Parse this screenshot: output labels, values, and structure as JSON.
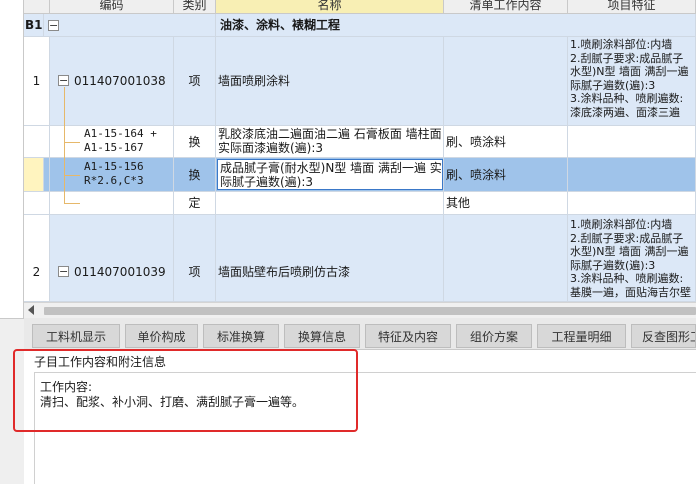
{
  "grid": {
    "headers": {
      "code": "编码",
      "type": "类别",
      "name": "名称",
      "content": "清单工作内容",
      "feature": "项目特征"
    },
    "section": {
      "id": "B1",
      "title": "油漆、涂料、裱糊工程"
    },
    "rows": [
      {
        "num": "1",
        "code": "011407001038",
        "type": "项",
        "name": "墙面喷刷涂料",
        "content": "",
        "feature_lines": [
          "1.喷刷涂料部位:内墙",
          "2.刮腻子要求:成品腻子",
          "水型)N型 墙面 满刮一遍",
          "际腻子遍数(遍):3",
          "3.涂料品种、喷刷遍数:",
          "漆底漆两遍、面漆三遍"
        ]
      },
      {
        "code_lines": [
          "A1-15-164 +",
          "A1-15-167"
        ],
        "type": "换",
        "name": "乳胶漆底油二遍面油二遍 石膏板面 墙柱面  实际面漆遍数(遍):3",
        "content": "刷、喷涂料"
      },
      {
        "code_lines": [
          "A1-15-156",
          "R*2.6,C*3"
        ],
        "type": "换",
        "name": "成品腻子膏(耐水型)N型 墙面 满刮一遍 实际腻子遍数(遍):3",
        "content": "刷、喷涂料"
      },
      {
        "type": "定",
        "content": "其他"
      },
      {
        "num": "2",
        "code": "011407001039",
        "type": "项",
        "name": "墙面贴壁布后喷刷仿古漆",
        "content": "",
        "feature_lines": [
          "1.喷刷涂料部位:内墙",
          "2.刮腻子要求:成品腻子",
          "水型)N型 墙面 满刮一遍",
          "际腻子遍数(遍):3",
          "3.涂料品种、喷刷遍数:",
          "基膜一遍，面贴海吉尔壁"
        ]
      }
    ]
  },
  "tabs": [
    "工料机显示",
    "单价构成",
    "标准换算",
    "换算信息",
    "特征及内容",
    "组价方案",
    "工程量明细",
    "反查图形工"
  ],
  "panel": {
    "title": "子目工作内容和附注信息",
    "work_label": "工作内容:",
    "work_text": "清扫、配浆、补小洞、打磨、满刮腻子膏一遍等。"
  },
  "colors": {
    "row_blue": "#dce8f7",
    "row_selected": "#9fc3ea",
    "highlight": "#e02a2a"
  }
}
